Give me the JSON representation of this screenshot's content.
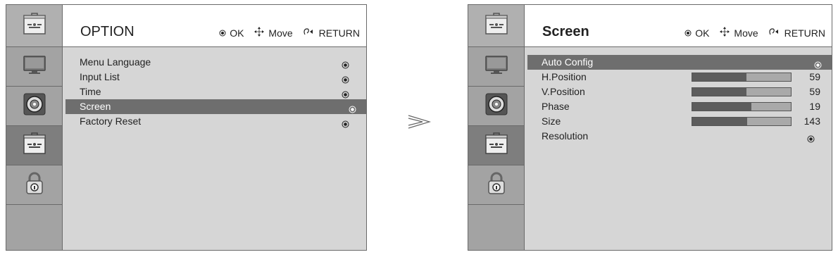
{
  "left_panel": {
    "title": "OPTION",
    "hints": {
      "ok": "OK",
      "move": "Move",
      "return": "RETURN"
    },
    "sidebar": [
      {
        "name": "tool",
        "icon": "toolbox-icon",
        "active": false,
        "top": true
      },
      {
        "name": "picture",
        "icon": "monitor-icon",
        "active": false
      },
      {
        "name": "audio",
        "icon": "speaker-icon",
        "active": false
      },
      {
        "name": "option",
        "icon": "toolbox-icon",
        "active": true
      },
      {
        "name": "lock",
        "icon": "padlock-icon",
        "active": false
      },
      {
        "name": "empty",
        "icon": "",
        "active": false
      }
    ],
    "items": [
      {
        "label": "Menu Language"
      },
      {
        "label": "Input List"
      },
      {
        "label": "Time"
      },
      {
        "label": "Screen",
        "highlight": true
      },
      {
        "label": "Factory Reset"
      }
    ]
  },
  "right_panel": {
    "title": "Screen",
    "hints": {
      "ok": "OK",
      "move": "Move",
      "return": "RETURN"
    },
    "items": [
      {
        "label": "Auto Config",
        "highlight": true,
        "type": "select"
      },
      {
        "label": "H.Position",
        "type": "bar",
        "value": "59",
        "level": 0.55
      },
      {
        "label": "V.Position",
        "type": "bar",
        "value": "59",
        "level": 0.55
      },
      {
        "label": "Phase",
        "type": "bar",
        "value": "19",
        "level": 0.6
      },
      {
        "label": "Size",
        "type": "bar",
        "value": "143",
        "level": 0.56
      },
      {
        "label": "Resolution",
        "type": "select"
      }
    ]
  },
  "colors": {
    "highlight": "#6e6e6e",
    "panel_bg": "#d6d6d6",
    "sidebar_bg": "#a3a3a3"
  }
}
